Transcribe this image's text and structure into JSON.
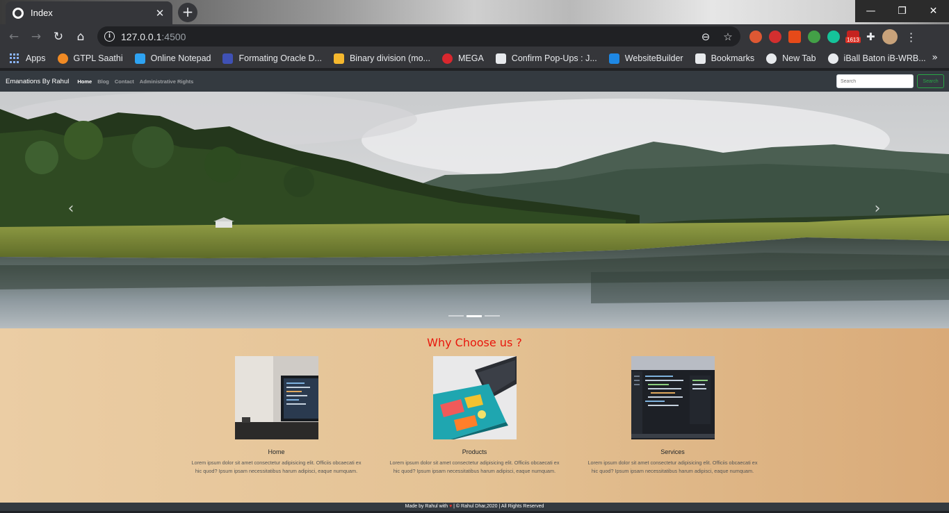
{
  "browser": {
    "tab_title": "Index",
    "tab_close": "✕",
    "new_tab": "+",
    "window_controls": {
      "minimize": "—",
      "restore": "❐",
      "close": "✕"
    },
    "url_host": "127.0.0.1",
    "url_port": ":4500",
    "extension_badge": "1613",
    "bookmarks": [
      {
        "label": "Apps",
        "icon": "apps-grid-icon",
        "color": "#8ab4f8"
      },
      {
        "label": "GTPL Saathi",
        "icon": "gtpl-icon",
        "color": "#f08a24"
      },
      {
        "label": "Online Notepad",
        "icon": "notepad-icon",
        "color": "#2ea3f2"
      },
      {
        "label": "Formating Oracle D...",
        "icon": "play-icon",
        "color": "#3f51b5"
      },
      {
        "label": "Binary division (mo...",
        "icon": "binary-icon",
        "color": "#f5b82e"
      },
      {
        "label": "MEGA",
        "icon": "mega-icon",
        "color": "#d9272e"
      },
      {
        "label": "Confirm Pop-Ups : J...",
        "icon": "popup-icon",
        "color": "#e8eaed"
      },
      {
        "label": "WebsiteBuilder",
        "icon": "gear-icon",
        "color": "#1e88e5"
      },
      {
        "label": "Bookmarks",
        "icon": "star-icon",
        "color": "#e8eaed"
      },
      {
        "label": "New Tab",
        "icon": "globe-icon",
        "color": "#e8eaed"
      },
      {
        "label": "iBall Baton iB-WRB...",
        "icon": "globe-icon",
        "color": "#e8eaed"
      }
    ],
    "bookmarks_more": "»"
  },
  "site": {
    "brand": "Emanations By Rahul",
    "nav": [
      {
        "label": "Home",
        "active": true
      },
      {
        "label": "Blog",
        "active": false
      },
      {
        "label": "Contact",
        "active": false
      },
      {
        "label": "Administrative Rights",
        "active": false
      }
    ],
    "search_placeholder": "Search",
    "search_button": "Search",
    "carousel": {
      "prev": "‹",
      "next": "›",
      "slide_count": 3,
      "active_slide": 2
    },
    "features_title": "Why Choose us ?",
    "features": [
      {
        "name": "Home",
        "text": "Lorem ipsum dolor sit amet consectetur adipisicing elit. Officiis obcaecati ex hic quod? Ipsum ipsam necessitatibus harum adipisci, eaque numquam."
      },
      {
        "name": "Products",
        "text": "Lorem ipsum dolor sit amet consectetur adipisicing elit. Officiis obcaecati ex hic quod? Ipsum ipsam necessitatibus harum adipisci, eaque numquam."
      },
      {
        "name": "Services",
        "text": "Lorem ipsum dolor sit amet consectetur adipisicing elit. Officiis obcaecati ex hic quod? Ipsum ipsam necessitatibus harum adipisci, eaque numquam."
      }
    ],
    "footer": {
      "made_by": "Made by Rahul with",
      "heart": "♥",
      "copyright": "| © Rahul Dhar,2020 | All Rights Reserved"
    }
  },
  "colors": {
    "accent_title": "#e8160c",
    "navbar": "#343a40",
    "search_green": "#28a745"
  }
}
